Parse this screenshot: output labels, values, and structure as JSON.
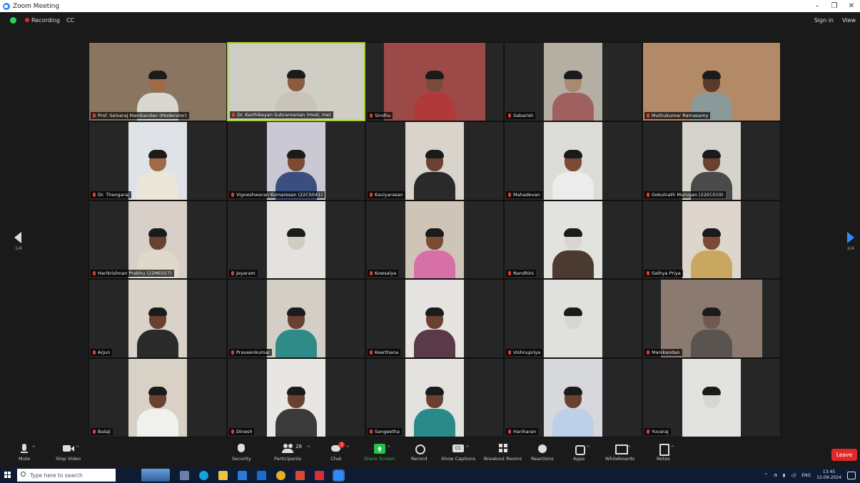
{
  "window": {
    "title": "Zoom Meeting",
    "controls": [
      "–",
      "❐",
      "✕"
    ]
  },
  "infobar": {
    "recording": "Recording",
    "cc": "CC",
    "signin": "Sign in",
    "view": "View"
  },
  "colors": {
    "accent": "#2d8cff",
    "active_border": "#a4d22a",
    "muted": "#e23b3b",
    "share": "#23c24b",
    "leave": "#e02828"
  },
  "pager": {
    "left": "1/4",
    "right": "2/4"
  },
  "tiles": [
    {
      "name": "Prof. Selvaraj Manikandan (Moderator)",
      "bg": "#8a7560",
      "skin": "#9e6a48",
      "shirt": "#d8d8d0",
      "wide": true,
      "active": false
    },
    {
      "name": "Dr. Karthikeyan Subramanian (Host, me)",
      "bg": "#cfcdc4",
      "skin": "#8c5a3c",
      "shirt": "#c8c4bc",
      "wide": true,
      "active": true
    },
    {
      "name": "Sindhu",
      "bg": "#9c4a48",
      "skin": "#7a4a38",
      "shirt": "#b03a3a",
      "wide": false,
      "active": false
    },
    {
      "name": "Sabarish",
      "bg": "#b5aea3",
      "skin": "#a88a70",
      "shirt": "#a06060",
      "wide": false,
      "active": false
    },
    {
      "name": "Muthukumar Ramasamy",
      "bg": "#b28a68",
      "skin": "#5a3a28",
      "shirt": "#8a9a9a",
      "wide": true,
      "active": false
    },
    {
      "name": "Dr. Thangaraj",
      "bg": "#dfe3e8",
      "skin": "#9e6a48",
      "shirt": "#ece6d8",
      "wide": false,
      "active": false
    },
    {
      "name": "Vigneshwaran Kumaresan (22CS041)",
      "bg": "#c9c8d3",
      "skin": "#7a4a34",
      "shirt": "#3a4f80",
      "wide": false,
      "active": false
    },
    {
      "name": "Kaviyarasan",
      "bg": "#d8d4cc",
      "skin": "#6a4030",
      "shirt": "#2a2a2a",
      "wide": false,
      "active": false
    },
    {
      "name": "Mahadevan",
      "bg": "#dcdcd8",
      "skin": "#7a4a34",
      "shirt": "#ececec",
      "wide": false,
      "active": false
    },
    {
      "name": "Gokulnath Murugan (22EC019)",
      "bg": "#d6d2cc",
      "skin": "#6a4030",
      "shirt": "#4a4a4a",
      "wide": false,
      "active": false
    },
    {
      "name": "Harikrishnan Prabhu (22ME027)",
      "bg": "#d8d0c8",
      "skin": "#6a4030",
      "shirt": "#e0d8c8",
      "wide": false,
      "active": false
    },
    {
      "name": "Jeyaram",
      "bg": "#e4e2de",
      "skin": "#d0ccc4",
      "shirt": "#e4e2de",
      "wide": false,
      "active": false
    },
    {
      "name": "Kowsalya",
      "bg": "#cfc4b8",
      "skin": "#7a4a34",
      "shirt": "#d870a8",
      "wide": false,
      "active": false
    },
    {
      "name": "Nandhini",
      "bg": "#e2e2de",
      "skin": "#d8d6d0",
      "shirt": "#4a3a30",
      "wide": false,
      "active": false
    },
    {
      "name": "Sathya Priya",
      "bg": "#ded6cc",
      "skin": "#7a4a34",
      "shirt": "#c8a860",
      "wide": false,
      "active": false
    },
    {
      "name": "Arjun",
      "bg": "#d8d2c8",
      "skin": "#6a4030",
      "shirt": "#2a2a2a",
      "wide": false,
      "active": false
    },
    {
      "name": "Praveenkumar",
      "bg": "#d4cfc6",
      "skin": "#6a4030",
      "shirt": "#2f8a88",
      "wide": false,
      "active": false
    },
    {
      "name": "Keerthana",
      "bg": "#e6e4e0",
      "skin": "#6a4030",
      "shirt": "#5a3a48",
      "wide": false,
      "active": false
    },
    {
      "name": "Vishnupriya",
      "bg": "#e0e0dc",
      "skin": "#d6d6d2",
      "shirt": "#e0e0dc",
      "wide": false,
      "active": false
    },
    {
      "name": "Manikandan",
      "bg": "#8a7a70",
      "skin": "#6e5a50",
      "shirt": "#5a5450",
      "wide": false,
      "active": false
    },
    {
      "name": "Balaji",
      "bg": "#d8d2c6",
      "skin": "#6a4030",
      "shirt": "#f0f0ec",
      "wide": false,
      "active": false
    },
    {
      "name": "Dinesh",
      "bg": "#e8e6e2",
      "skin": "#6a4030",
      "shirt": "#3a3a3a",
      "wide": false,
      "active": false
    },
    {
      "name": "Sangeetha",
      "bg": "#e4e2de",
      "skin": "#6a4030",
      "shirt": "#2a8a8a",
      "wide": false,
      "active": false
    },
    {
      "name": "Hariharan",
      "bg": "#d6d8dc",
      "skin": "#6a4030",
      "shirt": "#bcd0e8",
      "wide": false,
      "active": false
    },
    {
      "name": "Yuvaraj",
      "bg": "#e2e2de",
      "skin": "#d6d6d2",
      "shirt": "#e2e2de",
      "wide": false,
      "active": false
    }
  ],
  "toolbar": {
    "mute": "Mute",
    "stop_video": "Stop Video",
    "security": "Security",
    "participants": "Participants",
    "participants_count": "28",
    "chat": "Chat",
    "chat_badge": "3",
    "share": "Share Screen",
    "record": "Record",
    "captions": "Show Captions",
    "rooms": "Breakout Rooms",
    "reactions": "Reactions",
    "apps": "Apps",
    "whiteboards": "Whiteboards",
    "notes": "Notes",
    "leave": "Leave"
  },
  "taskbar": {
    "search_placeholder": "Type here to search",
    "lang": "ENG",
    "time": "13:45",
    "date": "12-09-2024"
  }
}
